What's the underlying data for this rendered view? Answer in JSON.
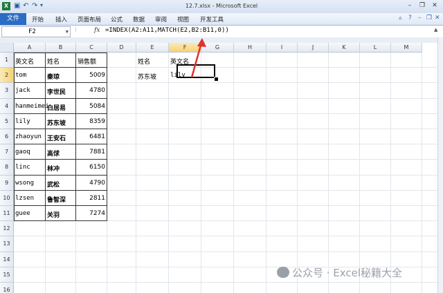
{
  "window": {
    "title": "12.7.xlsx - Microsoft Excel"
  },
  "ribbon": {
    "file_tab": "文件",
    "tabs": [
      "开始",
      "插入",
      "页面布局",
      "公式",
      "数据",
      "审阅",
      "视图",
      "开发工具"
    ]
  },
  "formula_bar": {
    "name_box": "F2",
    "fx": "fx",
    "formula": "=INDEX(A2:A11,MATCH(E2,B2:B11,0))"
  },
  "columns": [
    "A",
    "B",
    "C",
    "D",
    "E",
    "F",
    "G",
    "H",
    "I",
    "J",
    "K",
    "L",
    "M"
  ],
  "rows": [
    "1",
    "2",
    "3",
    "4",
    "5",
    "6",
    "7",
    "8",
    "9",
    "10",
    "11",
    "12",
    "13",
    "14",
    "15",
    "16"
  ],
  "table": {
    "headers": [
      "英文名",
      "姓名",
      "销售额"
    ],
    "rows": [
      [
        "tom",
        "秦琼",
        "5009"
      ],
      [
        "jack",
        "李世民",
        "4780"
      ],
      [
        "hanmeimei",
        "白居易",
        "5084"
      ],
      [
        "lily",
        "苏东坡",
        "8359"
      ],
      [
        "zhaoyun",
        "王安石",
        "6481"
      ],
      [
        "gaoq",
        "高俅",
        "7881"
      ],
      [
        "linc",
        "林冲",
        "6150"
      ],
      [
        "wsong",
        "武松",
        "4790"
      ],
      [
        "lzsen",
        "鲁智深",
        "2811"
      ],
      [
        "guee",
        "关羽",
        "7274"
      ]
    ]
  },
  "lookup": {
    "e1": "姓名",
    "f1": "英文名",
    "e2": "苏东坡",
    "f2": "lily"
  },
  "watermark": "公众号 · Excel秘籍大全",
  "colors": {
    "accent": "#2b6cc4",
    "arrow": "#e0322c",
    "active_header": "#f6d276"
  }
}
